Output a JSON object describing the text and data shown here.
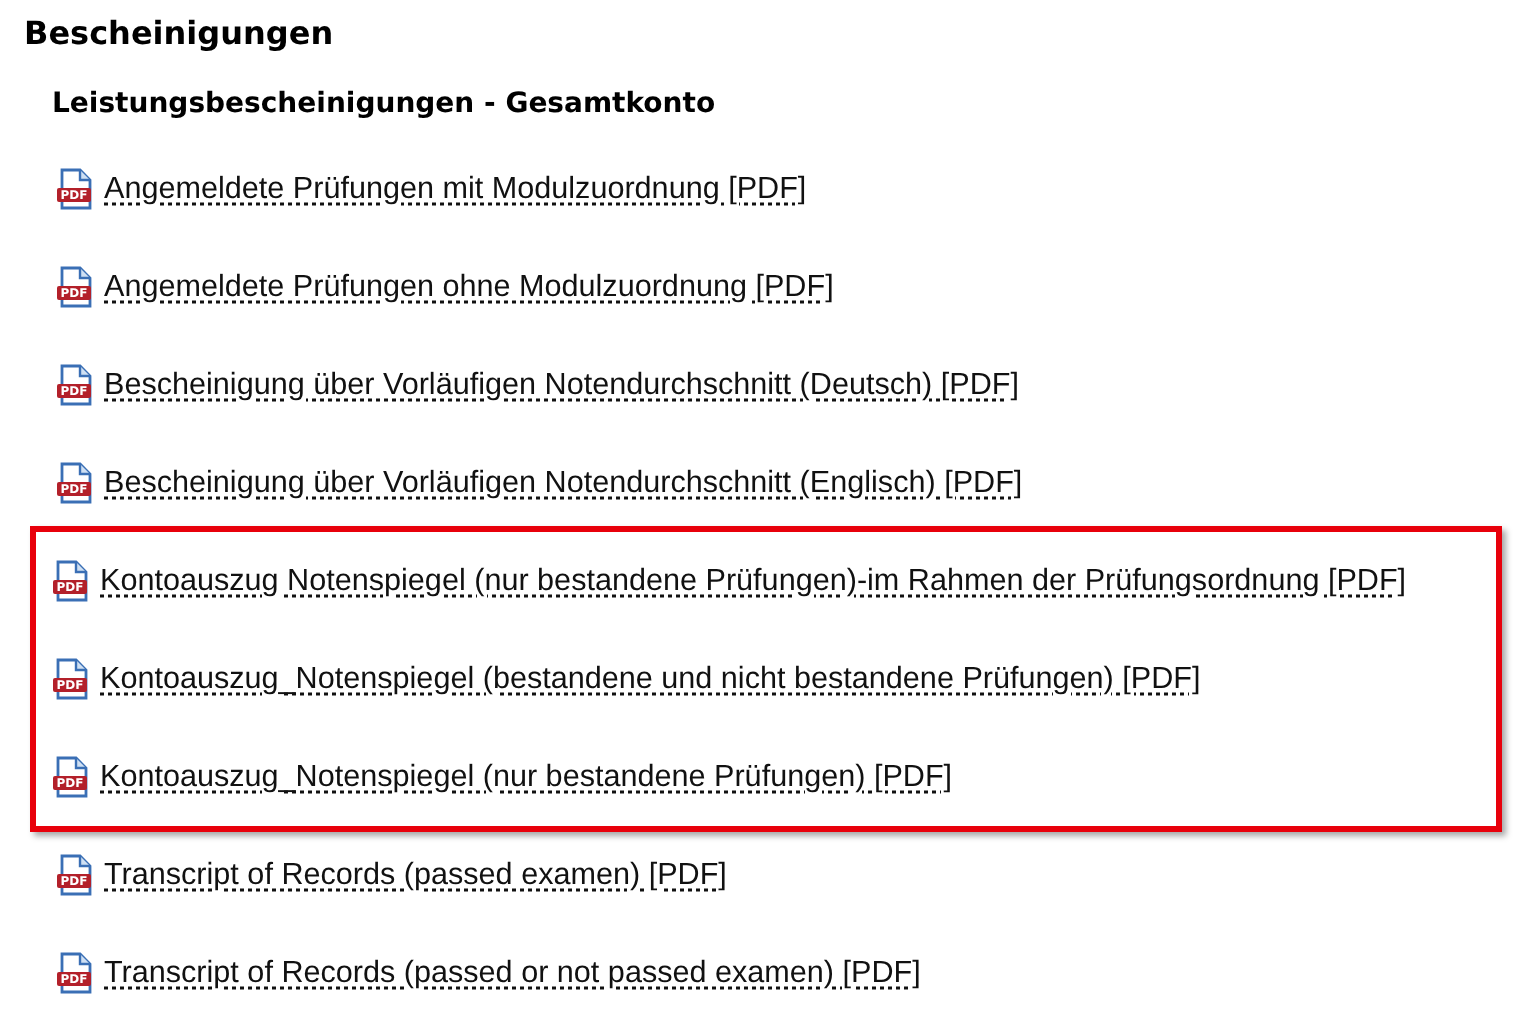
{
  "title": "Bescheinigungen",
  "section": {
    "heading": "Leistungsbescheinigungen - Gesamtkonto",
    "groups": [
      {
        "highlighted": false,
        "links": [
          {
            "label": "Angemeldete Prüfungen mit Modulzuordnung [PDF]",
            "icon_text": "PDF"
          },
          {
            "label": "Angemeldete Prüfungen ohne Modulzuordnung [PDF]",
            "icon_text": "PDF"
          },
          {
            "label": "Bescheinigung über Vorläufigen Notendurchschnitt (Deutsch) [PDF]",
            "icon_text": "PDF"
          },
          {
            "label": "Bescheinigung über Vorläufigen Notendurchschnitt (Englisch) [PDF]",
            "icon_text": "PDF"
          }
        ]
      },
      {
        "highlighted": true,
        "links": [
          {
            "label": "Kontoauszug Notenspiegel (nur bestandene Prüfungen)-im Rahmen der Prüfungsordnung [PDF]",
            "icon_text": "PDF"
          },
          {
            "label": "Kontoauszug_Notenspiegel (bestandene und nicht bestandene Prüfungen) [PDF]",
            "icon_text": "PDF"
          },
          {
            "label": "Kontoauszug_Notenspiegel (nur bestandene Prüfungen) [PDF]",
            "icon_text": "PDF"
          }
        ]
      },
      {
        "highlighted": false,
        "links": [
          {
            "label": "Transcript of Records (passed examen) [PDF]",
            "icon_text": "PDF"
          },
          {
            "label": "Transcript of Records (passed or not passed examen) [PDF]",
            "icon_text": "PDF"
          }
        ]
      }
    ]
  }
}
